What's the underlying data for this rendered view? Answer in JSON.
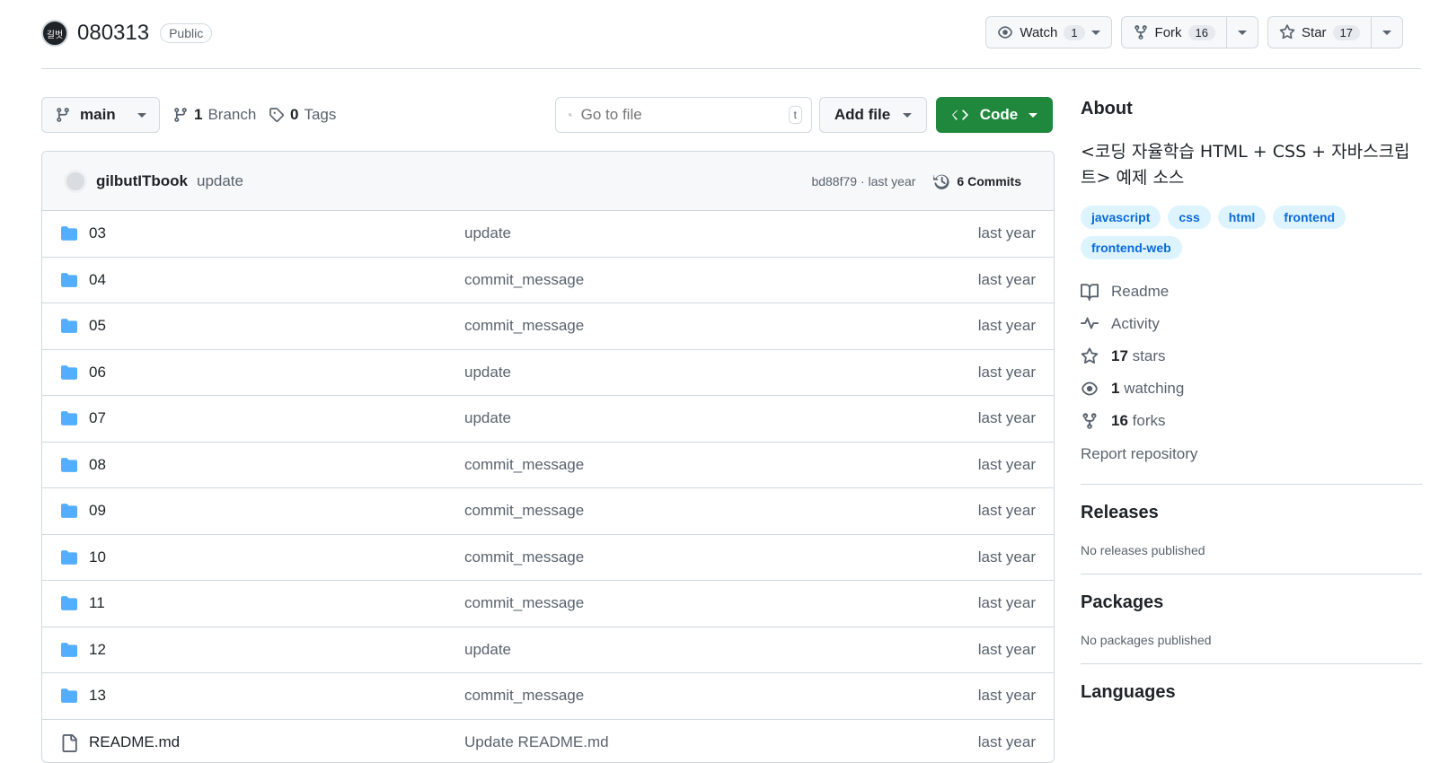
{
  "repo": {
    "avatar_text": "길벗",
    "name": "080313",
    "visibility": "Public"
  },
  "header_actions": {
    "watch_label": "Watch",
    "watch_count": "1",
    "fork_label": "Fork",
    "fork_count": "16",
    "star_label": "Star",
    "star_count": "17"
  },
  "toolbar": {
    "branch": "main",
    "branches_count": "1",
    "branches_label": "Branch",
    "tags_count": "0",
    "tags_label": "Tags",
    "search_placeholder": "Go to file",
    "search_shortcut": "t",
    "add_file_label": "Add file",
    "code_label": "Code"
  },
  "latest_commit": {
    "author": "gilbutITbook",
    "message": "update",
    "hash_time": "bd88f79 · last year",
    "commits_label": "6 Commits"
  },
  "files": [
    {
      "name": "03",
      "type": "folder",
      "message": "update",
      "date": "last year"
    },
    {
      "name": "04",
      "type": "folder",
      "message": "commit_message",
      "date": "last year"
    },
    {
      "name": "05",
      "type": "folder",
      "message": "commit_message",
      "date": "last year"
    },
    {
      "name": "06",
      "type": "folder",
      "message": "update",
      "date": "last year"
    },
    {
      "name": "07",
      "type": "folder",
      "message": "update",
      "date": "last year"
    },
    {
      "name": "08",
      "type": "folder",
      "message": "commit_message",
      "date": "last year"
    },
    {
      "name": "09",
      "type": "folder",
      "message": "commit_message",
      "date": "last year"
    },
    {
      "name": "10",
      "type": "folder",
      "message": "commit_message",
      "date": "last year"
    },
    {
      "name": "11",
      "type": "folder",
      "message": "commit_message",
      "date": "last year"
    },
    {
      "name": "12",
      "type": "folder",
      "message": "update",
      "date": "last year"
    },
    {
      "name": "13",
      "type": "folder",
      "message": "commit_message",
      "date": "last year"
    },
    {
      "name": "README.md",
      "type": "file",
      "message": "Update README.md",
      "date": "last year"
    }
  ],
  "about": {
    "heading": "About",
    "description": "<코딩 자율학습 HTML + CSS + 자바스크립트> 예제 소스",
    "topics": [
      "javascript",
      "css",
      "html",
      "frontend",
      "frontend-web"
    ],
    "readme_label": "Readme",
    "activity_label": "Activity",
    "stars_count": "17",
    "stars_label": "stars",
    "watching_count": "1",
    "watching_label": "watching",
    "forks_count": "16",
    "forks_label": "forks",
    "report_label": "Report repository"
  },
  "releases": {
    "heading": "Releases",
    "note": "No releases published"
  },
  "packages": {
    "heading": "Packages",
    "note": "No packages published"
  },
  "languages": {
    "heading": "Languages"
  },
  "colors": {
    "accent_green": "#1f883d",
    "folder_blue": "#54aeff",
    "topic_bg": "#ddf4ff",
    "link_blue": "#0969da"
  }
}
